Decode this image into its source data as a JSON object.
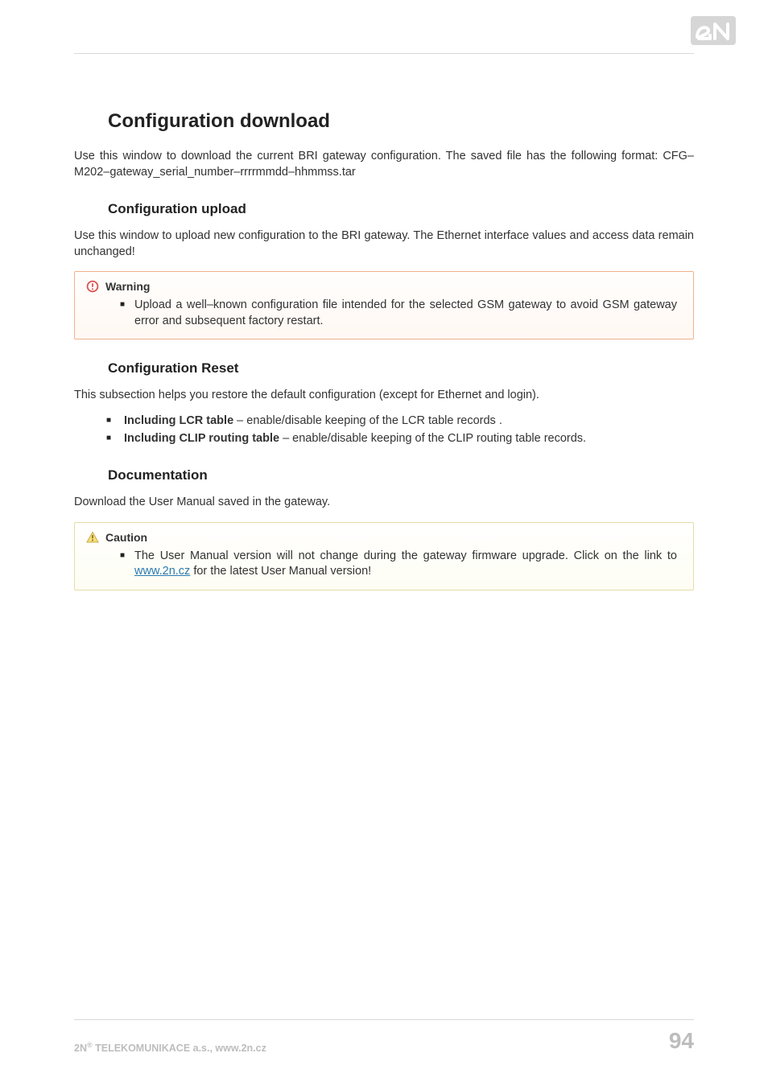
{
  "headings": {
    "h1": "Configuration download",
    "h2_upload": "Configuration upload",
    "h2_reset": "Configuration Reset",
    "h2_doc": "Documentation"
  },
  "paragraphs": {
    "download": "Use this window to download the current BRI gateway configuration. The saved file has the following format: CFG–M202–gateway_serial_number–rrrrmmdd–hhmmss.tar",
    "upload": "Use this window to upload new configuration to the BRI gateway. The Ethernet interface values and access data remain unchanged!",
    "reset": "This subsection helps you restore the default configuration (except for Ethernet and login).",
    "doc": "Download the User Manual saved in the gateway."
  },
  "reset_list": {
    "item1_bold": "Including LCR table",
    "item1_rest": " – enable/disable keeping of the LCR table records .",
    "item2_bold": "Including CLIP routing table",
    "item2_rest": " – enable/disable keeping of the CLIP routing table records."
  },
  "callouts": {
    "warning_title": "Warning",
    "warning_item": "Upload a well–known configuration file intended for the selected GSM gateway to avoid GSM gateway error and subsequent factory restart.",
    "caution_title": "Caution",
    "caution_pre": "The User Manual version will not change during the gateway firmware upgrade. Click on the link to ",
    "caution_link": "www.2n.cz",
    "caution_post": " for the latest User Manual version!"
  },
  "footer": {
    "left_pre": "2N",
    "left_sup": "®",
    "left_post": " TELEKOMUNIKACE a.s., www.2n.cz",
    "page": "94"
  }
}
